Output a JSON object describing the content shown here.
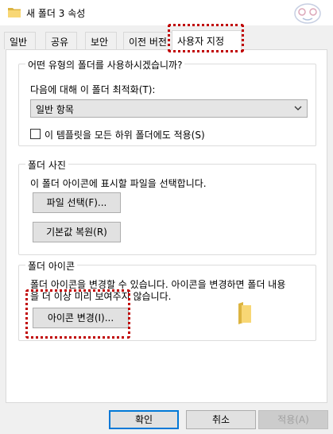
{
  "window": {
    "title": "새 폴더 3 속성"
  },
  "tabs": [
    {
      "label": "일반"
    },
    {
      "label": "공유"
    },
    {
      "label": "보안"
    },
    {
      "label": "이전 버전"
    },
    {
      "label": "사용자 지정"
    }
  ],
  "optimize": {
    "legend": "어떤 유형의 폴더를 사용하시겠습니까?",
    "optimize_label": "다음에 대해 이 폴더 최적화(T):",
    "selected_value": "일반 항목",
    "apply_checkbox_label": "이 템플릿을 모든 하위 폴더에도 적용(S)",
    "apply_checked": false
  },
  "folder_picture": {
    "legend": "폴더 사진",
    "description": "이 폴더 아이콘에 표시할 파일을 선택합니다.",
    "choose_file_button": "파일 선택(F)...",
    "restore_default_button": "기본값 복원(R)"
  },
  "folder_icon": {
    "legend": "폴더 아이콘",
    "description_line1": "폴더 아이콘을 변경할 수 있습니다. 아이콘을 변경하면 폴더 내용",
    "description_line2": "을 더 이상 미리 보여주지 않습니다.",
    "change_icon_button": "아이콘 변경(I)..."
  },
  "footer": {
    "ok_button": "확인",
    "cancel_button": "취소",
    "apply_button": "적용(A)"
  },
  "colors": {
    "highlight": "#c00000",
    "folder": "#f8d775",
    "accent": "#0078d7"
  }
}
